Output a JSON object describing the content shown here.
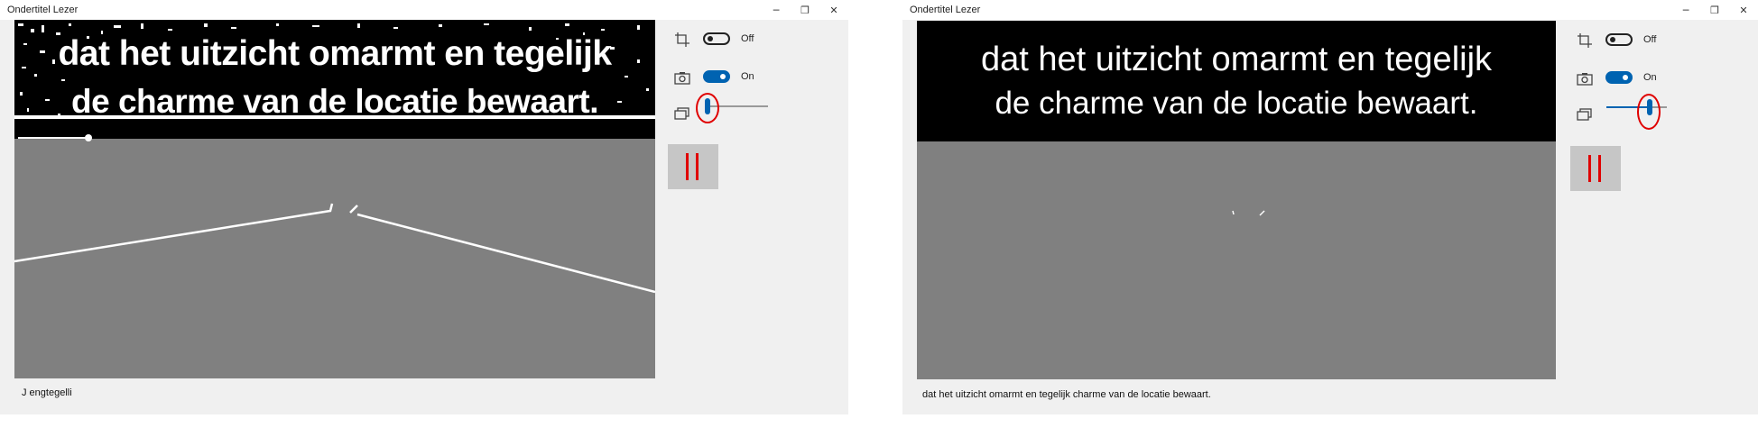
{
  "windows": [
    {
      "title": "Ondertitel Lezer",
      "caption": {
        "minimize": "─",
        "maximize": "❐",
        "close": "✕"
      },
      "subtitle_lines": [
        "dat het uitzicht omarmt en tegelijk",
        "de charme van de locatie bewaart."
      ],
      "crop_toggle": {
        "label": "Off",
        "state": "off"
      },
      "capture_toggle": {
        "label": "On",
        "state": "on"
      },
      "threshold_slider": {
        "value": 0.0
      },
      "pause_button": {
        "state": "paused"
      },
      "ocr_result": "J engtegelli"
    },
    {
      "title": "Ondertitel Lezer",
      "caption": {
        "minimize": "─",
        "maximize": "❐",
        "close": "✕"
      },
      "subtitle_lines": [
        "dat het uitzicht omarmt en tegelijk",
        "de charme van de locatie bewaart."
      ],
      "crop_toggle": {
        "label": "Off",
        "state": "off"
      },
      "capture_toggle": {
        "label": "On",
        "state": "on"
      },
      "threshold_slider": {
        "value": 0.68
      },
      "pause_button": {
        "state": "paused"
      },
      "ocr_result": "dat het uitzicht omarmt en tegelijk charme van de locatie bewaart."
    }
  ],
  "icons": {
    "crop": "crop-icon",
    "capture": "camera-icon",
    "threshold": "layers-icon",
    "pause": "pause-icon"
  },
  "colors": {
    "accent": "#0063b1",
    "highlight": "#e00000",
    "preview_gray": "#808080"
  }
}
